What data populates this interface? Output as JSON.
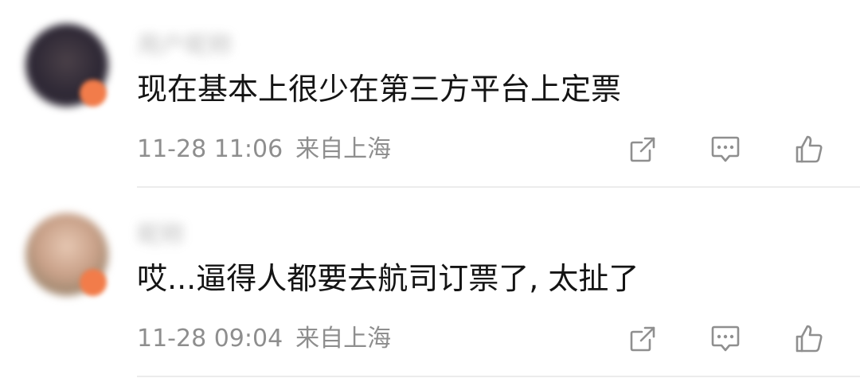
{
  "comments": [
    {
      "username": "用户昵称",
      "text": "现在基本上很少在第三方平台上定票",
      "time": "11-28 11:06",
      "location": "来自上海"
    },
    {
      "username": "昵称",
      "text": "哎...逼得人都要去航司订票了, 太扯了",
      "time": "11-28 09:04",
      "location": "来自上海"
    }
  ],
  "icons": {
    "share": "share-icon",
    "reply": "comment-icon",
    "like": "thumbs-up-icon"
  },
  "colors": {
    "text": "#141414",
    "meta": "#8e8e8e",
    "icon": "#8f8f8f",
    "divider": "#ececec",
    "badge": "#f27c4a"
  }
}
